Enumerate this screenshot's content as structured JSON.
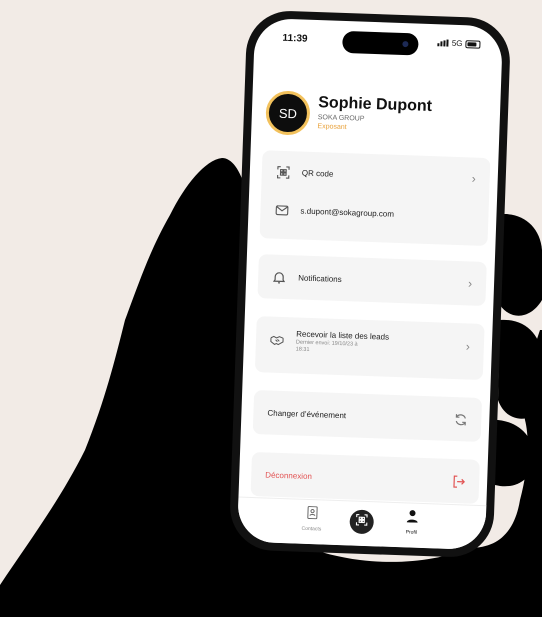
{
  "status_bar": {
    "time": "11:39",
    "network": "5G"
  },
  "profile": {
    "initials": "SD",
    "name": "Sophie Dupont",
    "company": "SOKA GROUP",
    "role": "Exposant",
    "accent_color": "#e9a23b"
  },
  "menu": {
    "qr_label": "QR code",
    "email": "s.dupont@sokagroup.com",
    "notifications_label": "Notifications",
    "leads_label": "Recevoir la liste des leads",
    "leads_sub": "Dernier envoi: 19/10/23 à 18:31",
    "change_event_label": "Changer d’événement",
    "logout_label": "Déconnexion",
    "logout_color": "#e25252"
  },
  "tabs": {
    "contacts": "Contacts",
    "profile": "Profil"
  },
  "icons": [
    "qr-code-icon",
    "mail-icon",
    "bell-icon",
    "handshake-icon",
    "refresh-icon",
    "logout-icon",
    "contacts-icon",
    "person-icon",
    "chevron-right-icon"
  ]
}
